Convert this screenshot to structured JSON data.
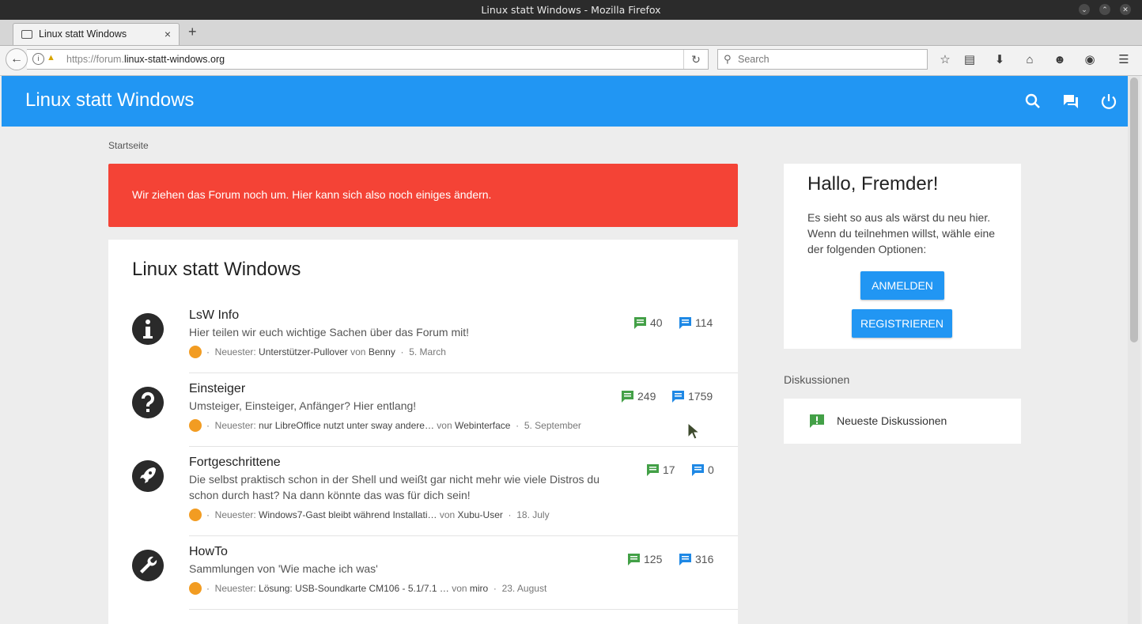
{
  "window": {
    "title": "Linux statt Windows - Mozilla Firefox"
  },
  "browser": {
    "tab_label": "Linux statt Windows",
    "tab_close": "×",
    "new_tab": "+",
    "url_proto": "https://forum.",
    "url_host": "linux-statt-windows.org",
    "search_placeholder": "Search",
    "toolbar_icons": [
      "bookmark-star-icon",
      "reading-list-icon",
      "download-icon",
      "home-icon",
      "chat-icon",
      "pocket-icon",
      "menu-icon"
    ]
  },
  "header": {
    "site_title": "Linux statt Windows",
    "icons": [
      "search-icon",
      "forum-icon",
      "power-icon"
    ],
    "bg_color": "#2196f3"
  },
  "breadcrumb": "Startseite",
  "alert": {
    "text": "Wir ziehen das Forum noch um. Hier kann sich also noch einiges ändern.",
    "color": "#f44336"
  },
  "main": {
    "title": "Linux statt Windows",
    "categories": [
      {
        "icon": "info-icon",
        "name": "LsW Info",
        "description": "Hier teilen wir euch wichtige Sachen über das Forum mit!",
        "latest_label": "Neuester:",
        "latest_topic": "Unterstützer-Pullover",
        "von": "von",
        "latest_user": "Benny",
        "latest_date": "5. March",
        "topics": "40",
        "posts": "114"
      },
      {
        "icon": "question-icon",
        "name": "Einsteiger",
        "description": "Umsteiger, Einsteiger, Anfänger? Hier entlang!",
        "latest_label": "Neuester:",
        "latest_topic": "nur LibreOffice nutzt unter sway andere…",
        "von": "von",
        "latest_user": "Webinterface",
        "latest_date": "5. September",
        "topics": "249",
        "posts": "1759"
      },
      {
        "icon": "rocket-icon",
        "name": "Fortgeschrittene",
        "description": "Die selbst praktisch schon in der Shell und weißt gar nicht mehr wie viele Distros du schon durch hast? Na dann könnte das was für dich sein!",
        "latest_label": "Neuester:",
        "latest_topic": "Windows7-Gast bleibt während Installati…",
        "von": "von",
        "latest_user": "Xubu-User",
        "latest_date": "18. July",
        "topics": "17",
        "posts": "0"
      },
      {
        "icon": "wrench-icon",
        "name": "HowTo",
        "description": "Sammlungen von 'Wie mache ich was'",
        "latest_label": "Neuester:",
        "latest_topic": "Lösung: USB-Soundkarte CM106 - 5.1/7.1 …",
        "von": "von",
        "latest_user": "miro",
        "latest_date": "23. August",
        "topics": "125",
        "posts": "316"
      }
    ]
  },
  "sidebar": {
    "greeting": "Hallo, Fremder!",
    "info": "Es sieht so aus als wärst du neu hier. Wenn du teilnehmen willst, wähle eine der folgenden Optionen:",
    "login_label": "ANMELDEN",
    "register_label": "REGISTRIEREN",
    "discussions_heading": "Diskussionen",
    "latest_discussions": "Neueste Diskussionen"
  },
  "colors": {
    "topic_icon": "#43a047",
    "post_icon": "#1e88e5",
    "rss": "#f29c22"
  }
}
